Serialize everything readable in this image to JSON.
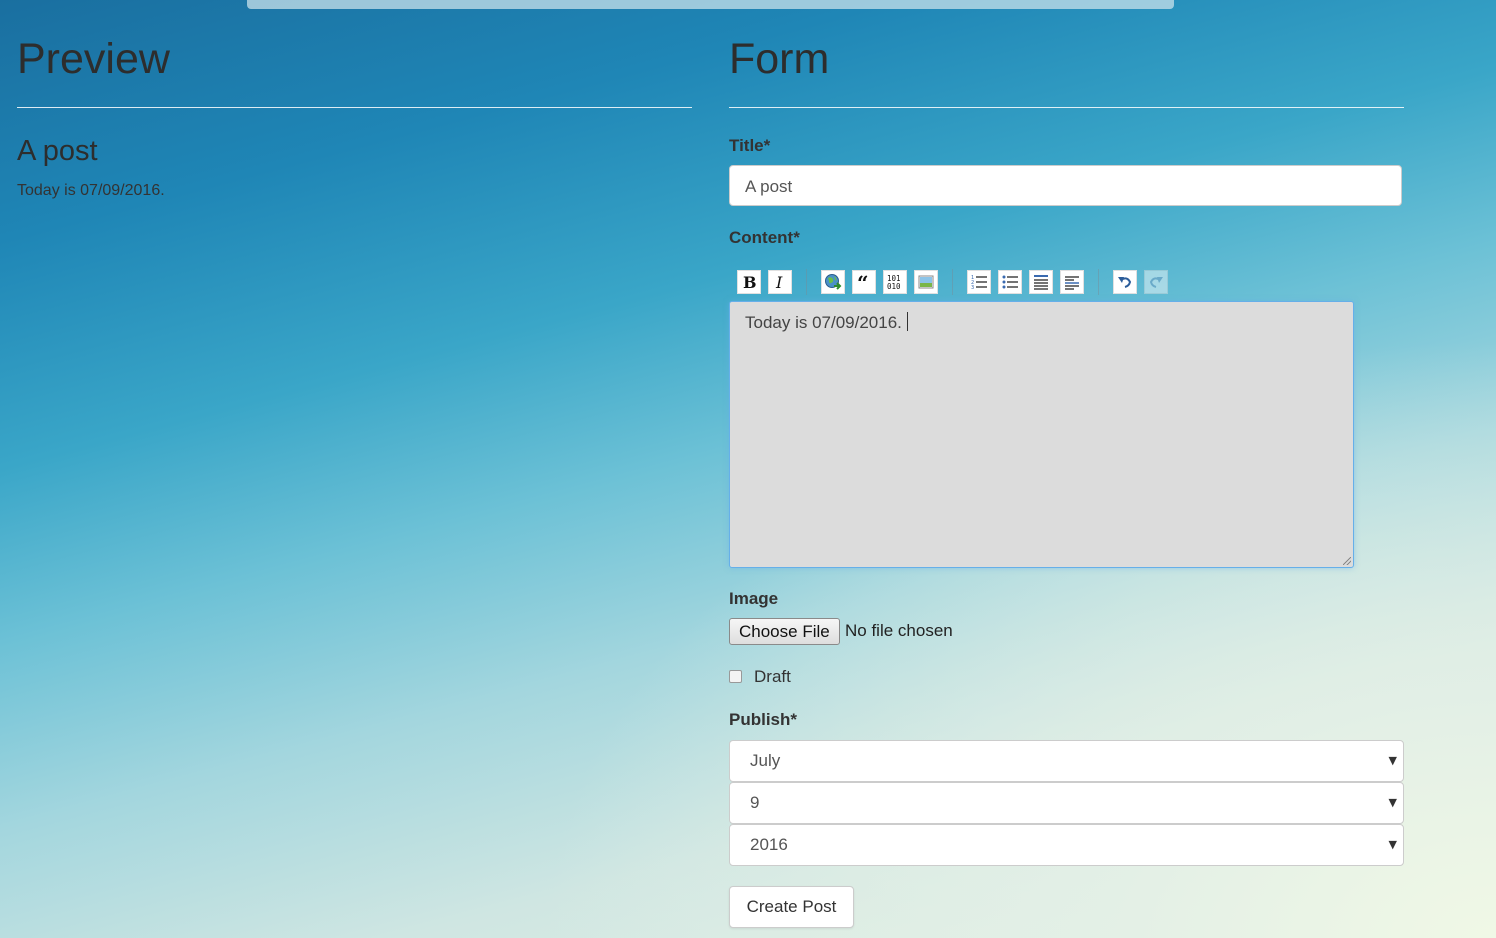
{
  "preview": {
    "heading": "Preview",
    "post_title": "A post",
    "post_body": "Today is 07/09/2016."
  },
  "form": {
    "heading": "Form",
    "title_label": "Title*",
    "title_value": "A post",
    "content_label": "Content*",
    "content_value": "Today is 07/09/2016.",
    "toolbar_icons": [
      "bold-icon",
      "italic-icon",
      "link-icon",
      "quote-icon",
      "code-icon",
      "image-icon",
      "ordered-list-icon",
      "unordered-list-icon",
      "heading-icon",
      "horizontal-rule-icon",
      "undo-icon",
      "redo-icon"
    ],
    "image_label": "Image",
    "choose_file_label": "Choose File",
    "file_status": "No file chosen",
    "draft_label": "Draft",
    "draft_checked": false,
    "publish_label": "Publish*",
    "publish_month": "July",
    "publish_day": "9",
    "publish_year": "2016",
    "submit_label": "Create Post"
  },
  "colors": {
    "editor_focus_border": "#66afe9",
    "editor_background": "#dcdcdc",
    "link_icon_green": "#4caf50"
  }
}
